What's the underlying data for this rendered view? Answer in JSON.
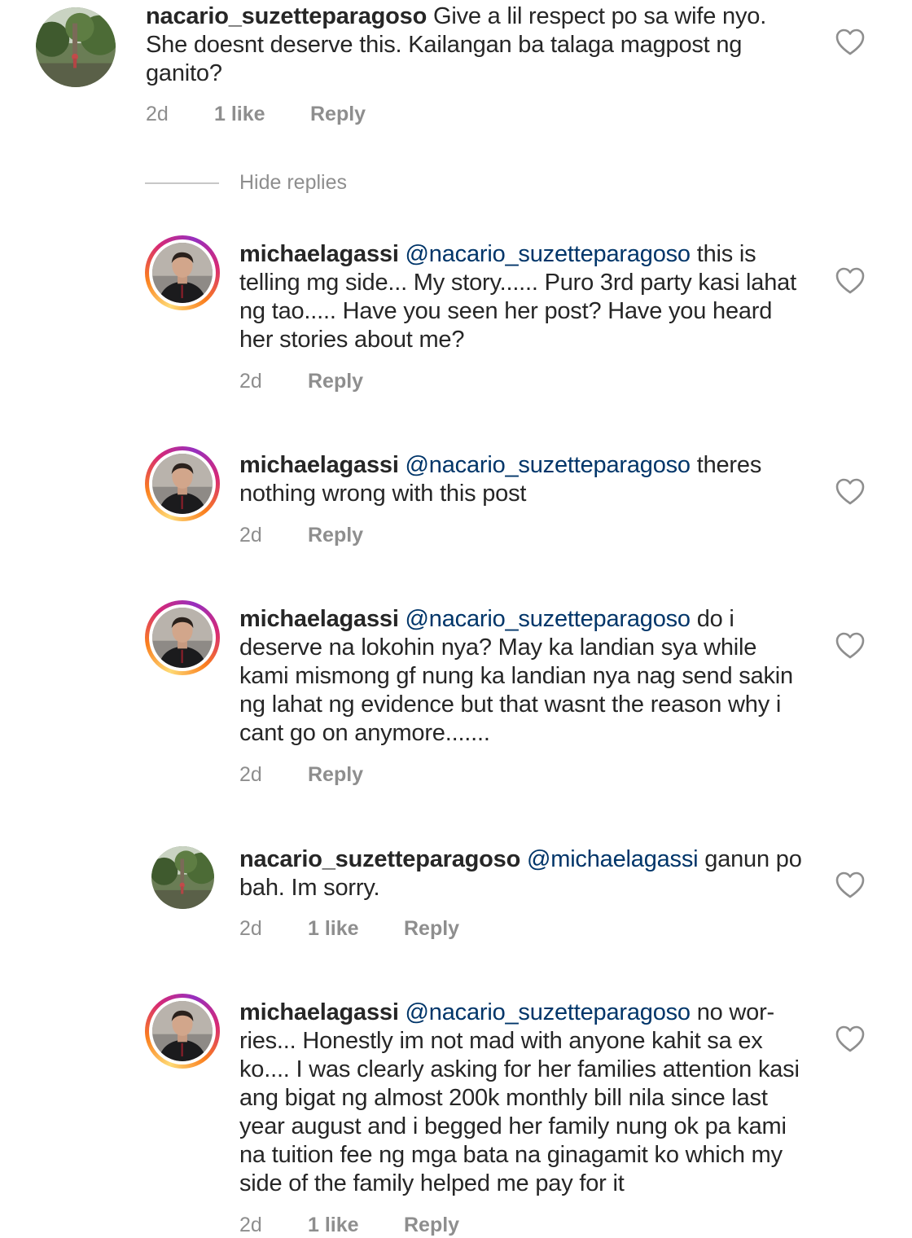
{
  "comments": [
    {
      "username": "nacario_suzetteparagoso",
      "mention": "",
      "text": " Give a lil respect po sa wife nyo. She doesnt deserve this. Kailangan ba talaga magpost ng ganito?",
      "time": "2d",
      "likes": "1 like",
      "reply": "Reply"
    },
    {
      "username": "michaelagassi",
      "mention": " @nacario_suzetteparagoso",
      "text": " this is telling mg side... My story...... Puro 3rd party kasi lahat ng tao..... Have you seen her post? Have you heard her stories about me?",
      "time": "2d",
      "likes": "",
      "reply": "Reply"
    },
    {
      "username": "michaelagassi",
      "mention": " @nacario_suzetteparagoso",
      "text": " theres nothing wrong with this post",
      "time": "2d",
      "likes": "",
      "reply": "Reply"
    },
    {
      "username": "michaelagassi",
      "mention": " @nacario_suzetteparagoso",
      "text": " do i deserve na lokohin nya? May ka landian sya while kami mismong gf nung ka landian nya nag send sakin ng lahat ng evidence but that wasnt the reason why i cant go on anymore.......",
      "time": "2d",
      "likes": "",
      "reply": "Reply"
    },
    {
      "username": "nacario_suzetteparagoso",
      "mention": " @michaelagassi",
      "text": " ganun po bah. Im sorry.",
      "time": "2d",
      "likes": "1 like",
      "reply": "Reply"
    },
    {
      "username": "michaelagassi",
      "mention": " @nacario_suzetteparagoso",
      "text": " no wor-ries... Honestly im not mad with anyone kahit sa ex ko.... I was clearly asking for her families attention kasi ang bigat ng almost 200k monthly bill nila since last year august and i begged her family nung ok pa kami na tuition fee ng mga bata na ginagamit ko which my side of the family helped me pay for it",
      "time": "2d",
      "likes": "1 like",
      "reply": "Reply"
    }
  ],
  "hide_replies": "Hide replies",
  "colors": {
    "text": "#262626",
    "mention": "#003569",
    "meta": "#8e8e8e",
    "heart": "#8e8e8e"
  },
  "icons": {
    "like": "heart-outline-icon",
    "avatar_a": "forest-photo-avatar",
    "avatar_b": "man-portrait-avatar"
  }
}
